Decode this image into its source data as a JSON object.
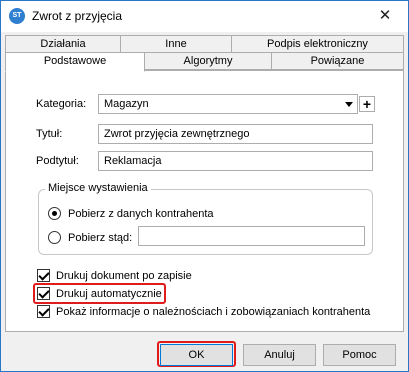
{
  "window": {
    "title": "Zwrot z przyjęcia",
    "close_glyph": "✕",
    "icon_text": "ST"
  },
  "tabs_top": [
    {
      "label": "Działania"
    },
    {
      "label": "Inne"
    },
    {
      "label": "Podpis elektroniczny"
    }
  ],
  "tabs_bottom": [
    {
      "label": "Podstawowe",
      "active": true
    },
    {
      "label": "Algorytmy"
    },
    {
      "label": "Powiązane"
    }
  ],
  "form": {
    "category_label": "Kategoria:",
    "category_value": "Magazyn",
    "plus_glyph": "+",
    "title_label": "Tytuł:",
    "title_value": "Zwrot przyjęcia zewnętrznego",
    "subtitle_label": "Podtytuł:",
    "subtitle_value": "Reklamacja"
  },
  "issue_place": {
    "legend": "Miejsce wystawienia",
    "option1": "Pobierz z danych kontrahenta",
    "option2": "Pobierz stąd:",
    "option2_value": ""
  },
  "checkboxes": [
    {
      "label": "Drukuj dokument po zapisie",
      "checked": true
    },
    {
      "label": "Drukuj automatycznie",
      "checked": true
    },
    {
      "label": "Pokaż informacje o należnościach i zobowiązaniach kontrahenta",
      "checked": true
    }
  ],
  "buttons": {
    "ok": "OK",
    "cancel": "Anuluj",
    "help": "Pomoc"
  },
  "colors": {
    "highlight": "#e01b1b",
    "accent": "#0078d7"
  }
}
